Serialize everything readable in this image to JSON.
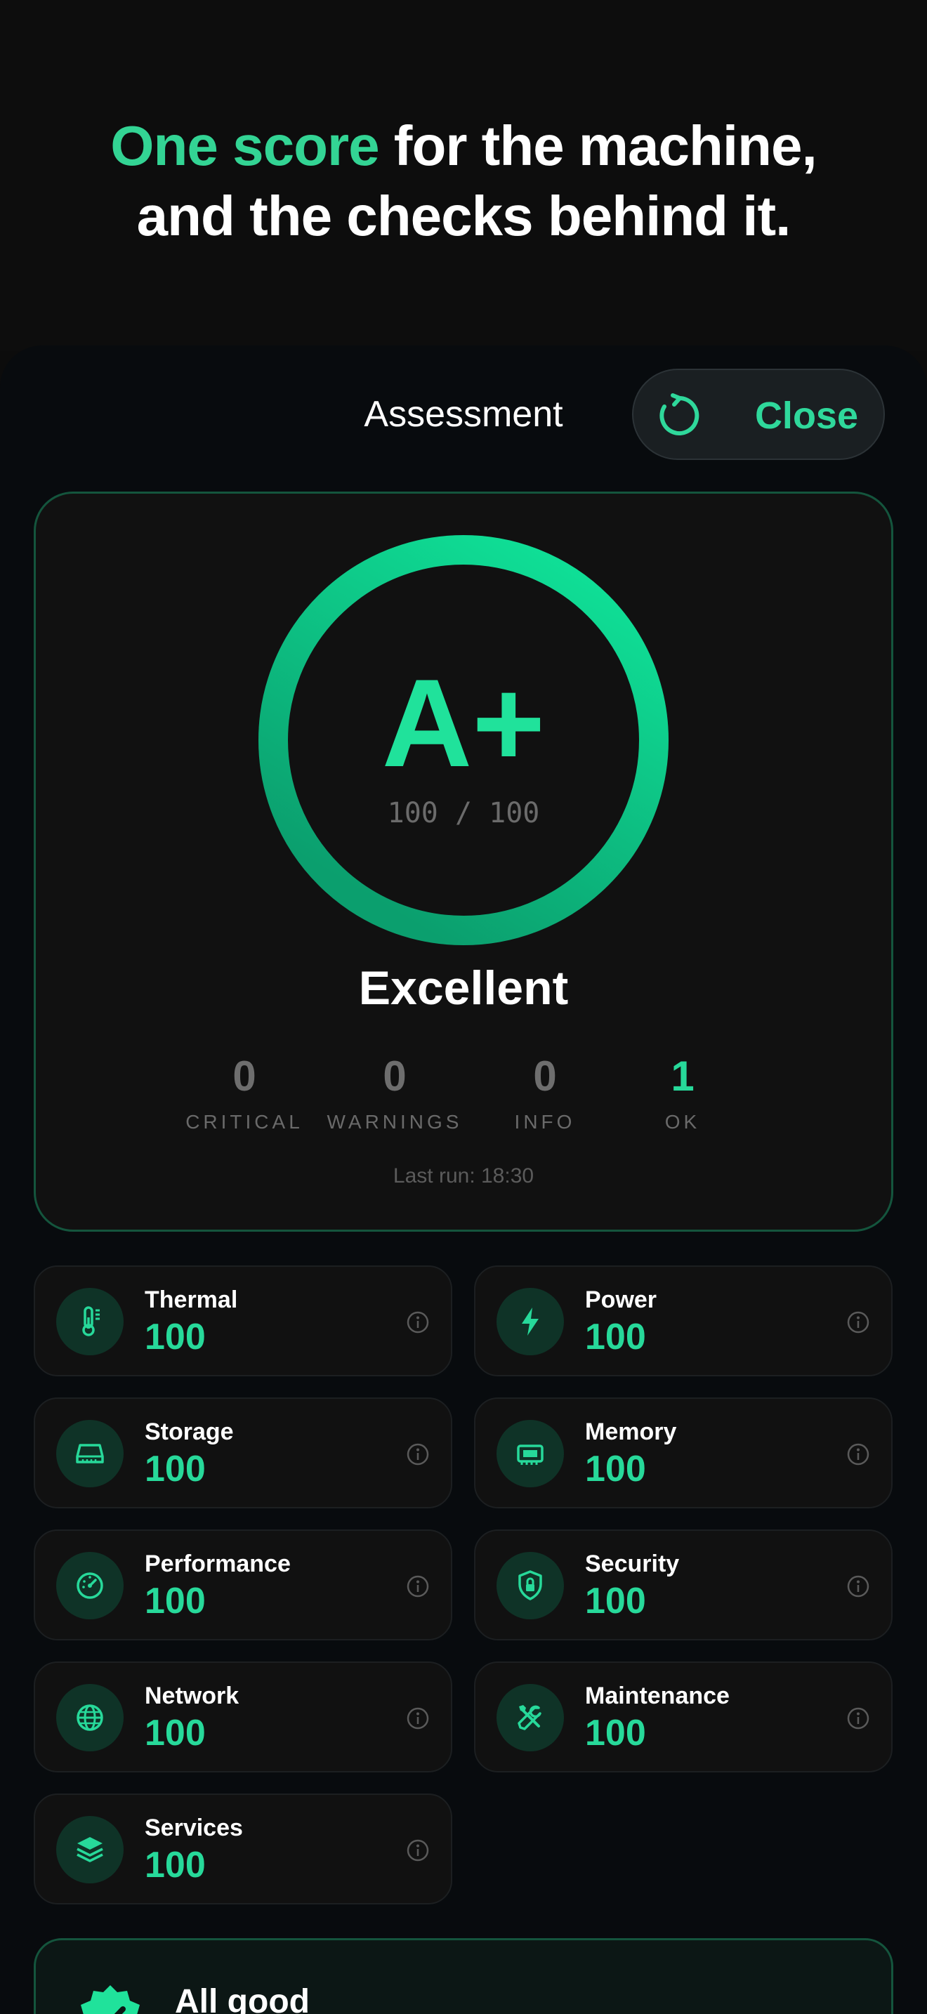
{
  "headline": {
    "accent": "One score",
    "rest": " for the machine,",
    "line2": "and the checks behind it."
  },
  "nav": {
    "title": "Assessment",
    "close_label": "Close"
  },
  "score": {
    "grade": "A+",
    "score_text": "100 / 100",
    "progress": 1.0,
    "status": "Excellent"
  },
  "stats": [
    {
      "value": "0",
      "label": "CRITICAL"
    },
    {
      "value": "0",
      "label": "WARNINGS"
    },
    {
      "value": "0",
      "label": "INFO"
    },
    {
      "value": "1",
      "label": "OK"
    }
  ],
  "last_run": "Last run: 18:30",
  "categories": [
    {
      "name": "Thermal",
      "value": "100",
      "icon": "thermometer-icon"
    },
    {
      "name": "Power",
      "value": "100",
      "icon": "bolt-icon"
    },
    {
      "name": "Storage",
      "value": "100",
      "icon": "drive-icon"
    },
    {
      "name": "Memory",
      "value": "100",
      "icon": "memory-chip-icon"
    },
    {
      "name": "Performance",
      "value": "100",
      "icon": "gauge-icon"
    },
    {
      "name": "Security",
      "value": "100",
      "icon": "shield-lock-icon"
    },
    {
      "name": "Network",
      "value": "100",
      "icon": "globe-icon"
    },
    {
      "name": "Maintenance",
      "value": "100",
      "icon": "tools-icon"
    },
    {
      "name": "Services",
      "value": "100",
      "icon": "stack-icon"
    }
  ],
  "banner": {
    "label": "All good",
    "icon": "checkmark-seal-icon"
  },
  "colors": {
    "accent": "#27d99a",
    "background": "#080b0e",
    "card": "#111111",
    "card_border": "#14553d"
  }
}
